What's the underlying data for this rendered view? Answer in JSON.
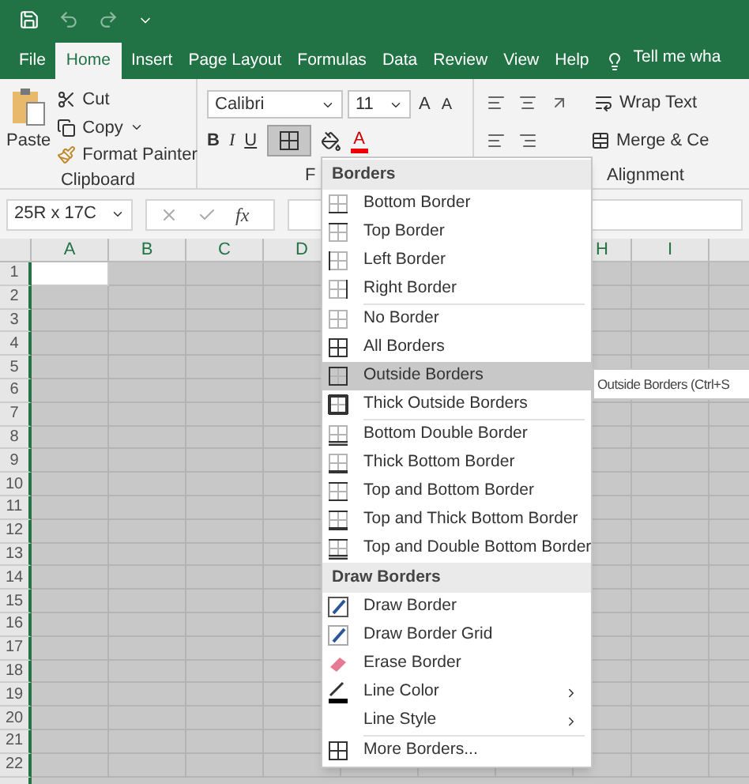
{
  "tabs": [
    {
      "label": "File",
      "selected": false
    },
    {
      "label": "Home",
      "selected": true
    },
    {
      "label": "Insert",
      "selected": false
    },
    {
      "label": "Page Layout",
      "selected": false
    },
    {
      "label": "Formulas",
      "selected": false
    },
    {
      "label": "Data",
      "selected": false
    },
    {
      "label": "Review",
      "selected": false
    },
    {
      "label": "View",
      "selected": false
    },
    {
      "label": "Help",
      "selected": false
    }
  ],
  "tell_me": "Tell me wha",
  "ribbon": {
    "clipboard": {
      "paste": "Paste",
      "cut": "Cut",
      "copy": "Copy",
      "format_painter": "Format Painter",
      "label": "Clipboard"
    },
    "font": {
      "font_name": "Calibri",
      "font_size": "11",
      "grow_font": "A",
      "shrink_font": "A",
      "bold": "B",
      "italic": "I",
      "underline": "U",
      "font_color": "A",
      "label": "F"
    },
    "alignment": {
      "wrap_text": "Wrap Text",
      "merge": "Merge & Ce",
      "label": "Alignment"
    }
  },
  "formula_bar": {
    "name_box": "25R x 17C",
    "function": "fx"
  },
  "sheet": {
    "columns": [
      "A",
      "B",
      "C",
      "D",
      "H",
      "I"
    ],
    "rows": [
      {
        "label": "1",
        "active": true
      },
      {
        "label": "2",
        "active": false
      },
      {
        "label": "3",
        "active": false
      },
      {
        "label": "4",
        "active": false
      },
      {
        "label": "5",
        "active": false
      },
      {
        "label": "6",
        "active": false
      },
      {
        "label": "7",
        "active": false
      },
      {
        "label": "8",
        "active": false
      },
      {
        "label": "9",
        "active": false
      },
      {
        "label": "10",
        "active": false
      },
      {
        "label": "11",
        "active": false
      },
      {
        "label": "12",
        "active": false
      },
      {
        "label": "13",
        "active": false
      },
      {
        "label": "14",
        "active": false
      },
      {
        "label": "15",
        "active": false
      },
      {
        "label": "16",
        "active": false
      },
      {
        "label": "17",
        "active": false
      },
      {
        "label": "18",
        "active": false
      },
      {
        "label": "19",
        "active": false
      },
      {
        "label": "20",
        "active": false
      },
      {
        "label": "21",
        "active": false
      },
      {
        "label": "22",
        "active": false
      }
    ]
  },
  "borders_menu": [
    {
      "kind": "header",
      "label": "Borders"
    },
    {
      "kind": "item",
      "label": "Bottom Border",
      "highlighted": false
    },
    {
      "kind": "item",
      "label": "Top Border",
      "highlighted": false
    },
    {
      "kind": "item",
      "label": "Left Border",
      "highlighted": false
    },
    {
      "kind": "item",
      "label": "Right Border",
      "highlighted": false
    },
    {
      "kind": "separator"
    },
    {
      "kind": "item",
      "label": "No Border",
      "highlighted": false
    },
    {
      "kind": "item",
      "label": "All Borders",
      "highlighted": false
    },
    {
      "kind": "item",
      "label": "Outside Borders",
      "highlighted": true
    },
    {
      "kind": "item",
      "label": "Thick Outside Borders",
      "highlighted": false
    },
    {
      "kind": "separator"
    },
    {
      "kind": "item",
      "label": "Bottom Double Border",
      "highlighted": false
    },
    {
      "kind": "item",
      "label": "Thick Bottom Border",
      "highlighted": false
    },
    {
      "kind": "item",
      "label": "Top and Bottom Border",
      "highlighted": false
    },
    {
      "kind": "item",
      "label": "Top and Thick Bottom Border",
      "highlighted": false
    },
    {
      "kind": "item",
      "label": "Top and Double Bottom Border",
      "highlighted": false
    },
    {
      "kind": "header",
      "label": "Draw Borders"
    },
    {
      "kind": "item",
      "label": "Draw Border",
      "highlighted": false
    },
    {
      "kind": "item",
      "label": "Draw Border Grid",
      "highlighted": false
    },
    {
      "kind": "item",
      "label": "Erase Border",
      "highlighted": false
    },
    {
      "kind": "submenu",
      "label": "Line Color",
      "highlighted": false
    },
    {
      "kind": "submenu",
      "label": "Line Style",
      "highlighted": false
    },
    {
      "kind": "separator"
    },
    {
      "kind": "item",
      "label": "More Borders...",
      "highlighted": false
    }
  ],
  "tooltip": "Outside Borders (Ctrl+S"
}
